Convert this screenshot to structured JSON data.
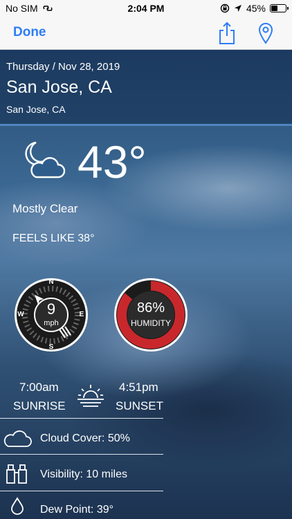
{
  "status": {
    "carrier": "No SIM",
    "time": "2:04 PM",
    "battery": "45%",
    "battery_level": 0.45
  },
  "nav": {
    "done_label": "Done"
  },
  "location": {
    "date": "Thursday / Nov 28, 2019",
    "city": "San Jose, CA",
    "region": "San Jose, CA"
  },
  "current": {
    "temperature": "43°",
    "condition": "Mostly Clear",
    "feels_like": "FEELS LIKE 38°"
  },
  "wind": {
    "speed": "9",
    "unit": "mph",
    "compass": {
      "n": "N",
      "s": "S",
      "e": "E",
      "w": "W"
    }
  },
  "humidity": {
    "value": "86%",
    "label": "HUMIDITY",
    "level": 0.86,
    "ring_color": "#c8282c"
  },
  "sun": {
    "sunrise_time": "7:00am",
    "sunrise_label": "SUNRISE",
    "sunset_time": "4:51pm",
    "sunset_label": "SUNSET"
  },
  "details": [
    {
      "icon": "cloud-icon",
      "text": "Cloud Cover: 50%"
    },
    {
      "icon": "binoculars-icon",
      "text": "Visibility: 10 miles"
    },
    {
      "icon": "droplet-icon",
      "text": "Dew Point: 39°"
    }
  ],
  "colors": {
    "accent": "#2f7df6"
  }
}
